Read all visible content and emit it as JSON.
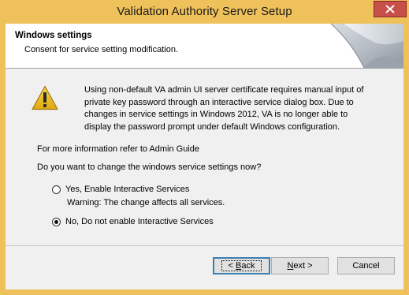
{
  "window": {
    "title": "Validation Authority Server Setup"
  },
  "header": {
    "title": "Windows settings",
    "subtitle": "Consent for service setting modification."
  },
  "body": {
    "warning_text": "Using non-default VA admin UI server certificate requires manual input of private key password through an interactive service dialog box. Due to changes in service settings in Windows 2012, VA is no longer able to display the password prompt under default Windows configuration.",
    "info_line": "For more information refer to Admin Guide",
    "question": "Do you want to change the windows service settings now?",
    "options": [
      {
        "label": "Yes, Enable Interactive Services",
        "selected": false
      },
      {
        "label": "No, Do not enable Interactive Services",
        "selected": true
      }
    ],
    "option_yes_note": "Warning: The change affects all services."
  },
  "buttons": {
    "back_prefix": "< ",
    "back_access": "B",
    "back_rest": "ack",
    "next_access": "N",
    "next_rest": "ext >",
    "cancel": "Cancel"
  },
  "colors": {
    "frame": "#efc15b",
    "close": "#c7504a",
    "client": "#f0f0f0"
  },
  "icons": [
    "close-icon",
    "warning-icon",
    "page-curl-art"
  ]
}
